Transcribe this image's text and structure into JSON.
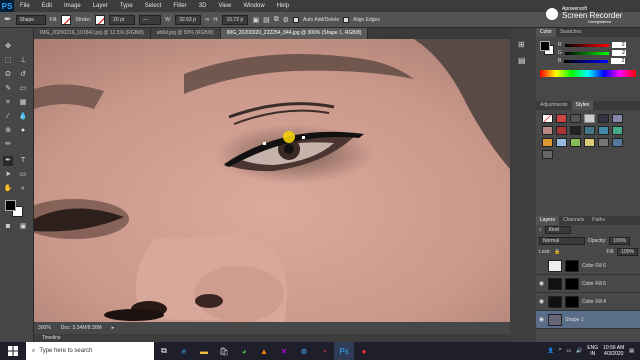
{
  "menu": {
    "items": [
      "PS",
      "File",
      "Edit",
      "Image",
      "Layer",
      "Type",
      "Select",
      "Filter",
      "3D",
      "View",
      "Window",
      "Help"
    ]
  },
  "options": {
    "mode": "Shape",
    "fill_label": "Fill:",
    "stroke_label": "Stroke:",
    "stroke_size": "20 pt",
    "w_label": "W:",
    "w_value": "32.63 p",
    "h_label": "H:",
    "h_value": "16.72 p",
    "auto_add_delete": "Auto Add/Delete",
    "align_edges": "Align Edges"
  },
  "recorder": {
    "brand": "Apowersoft",
    "title": "Screen Recorder",
    "badge": "Unregistered"
  },
  "tabs": [
    {
      "label": "IMG_20200216_101842.jpg @ 12.5% (RGB/8)"
    },
    {
      "label": "ab6d.jpg @ 50% (RGB/8)"
    },
    {
      "label": "IMG_20200320_222254_844.jpg @ 300% (Shape 1, RGB/8)"
    }
  ],
  "status": {
    "zoom": "300%",
    "doc": "Doc: 3.34M/8.30M",
    "timeline": "Timeline"
  },
  "color_panel": {
    "tabs": [
      "Color",
      "Swatches"
    ],
    "rows": [
      {
        "label": "R",
        "value": "2"
      },
      {
        "label": "G",
        "value": "2"
      },
      {
        "label": "B",
        "value": "2"
      }
    ]
  },
  "styles_panel": {
    "tabs": [
      "Adjustments",
      "Styles"
    ]
  },
  "layers_panel": {
    "tabs": [
      "Layers",
      "Channels",
      "Paths"
    ],
    "kind": "Kind",
    "blend_mode": "Normal",
    "opacity_label": "Opacity:",
    "opacity_value": "100%",
    "lock_label": "Lock:",
    "fill_label": "Fill:",
    "fill_value": "100%",
    "layers": [
      {
        "name": "Color Fill 6",
        "visible": false
      },
      {
        "name": "Color Fill 5",
        "visible": true
      },
      {
        "name": "Color Fill 4",
        "visible": true
      },
      {
        "name": "Shape 1",
        "visible": true
      }
    ]
  },
  "taskbar": {
    "search_placeholder": "Type here to search",
    "lang": "ENG",
    "region": "IN",
    "time": "10:56 AM",
    "date": "4/3/2020"
  },
  "colors": {
    "foreground": "#000000",
    "background": "#ffffff",
    "accent": "#31a8ff"
  }
}
